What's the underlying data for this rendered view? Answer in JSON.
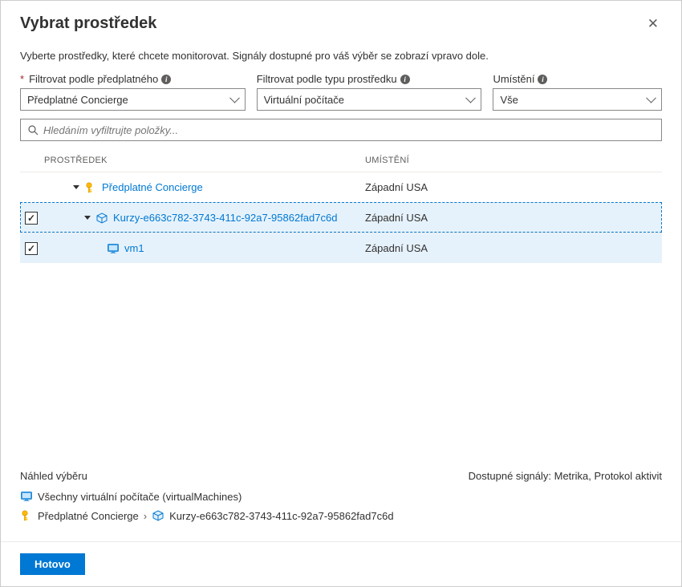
{
  "header": {
    "title": "Vybrat prostředek"
  },
  "instruction": "Vyberte prostředky, které chcete monitorovat. Signály dostupné pro váš výběr se zobrazí vpravo dole.",
  "filters": {
    "subscription": {
      "label": "Filtrovat podle předplatného",
      "value": "Předplatné Concierge",
      "required": true
    },
    "resourceType": {
      "label": "Filtrovat podle typu prostředku",
      "value": "Virtuální počítače"
    },
    "location": {
      "label": "Umístění",
      "value": "Vše"
    }
  },
  "search": {
    "placeholder": "Hledáním vyfiltrujte položky..."
  },
  "table": {
    "headers": {
      "resource": "PROSTŘEDEK",
      "location": "UMÍSTĚNÍ"
    },
    "rows": [
      {
        "name": "Předplatné Concierge",
        "location": "Západní USA"
      },
      {
        "name": "Kurzy-e663c782-3743-411c-92a7-95862fad7c6d",
        "location": "Západní USA"
      },
      {
        "name": "vm1",
        "location": "Západní USA"
      }
    ]
  },
  "preview": {
    "title": "Náhled výběru",
    "signals": "Dostupné signály: Metrika, Protokol aktivit",
    "summary": "Všechny virtuální počítače (virtualMachines)",
    "breadcrumb": {
      "sub": "Předplatné Concierge",
      "rg": "Kurzy-e663c782-3743-411c-92a7-95862fad7c6d"
    }
  },
  "footer": {
    "done": "Hotovo"
  }
}
